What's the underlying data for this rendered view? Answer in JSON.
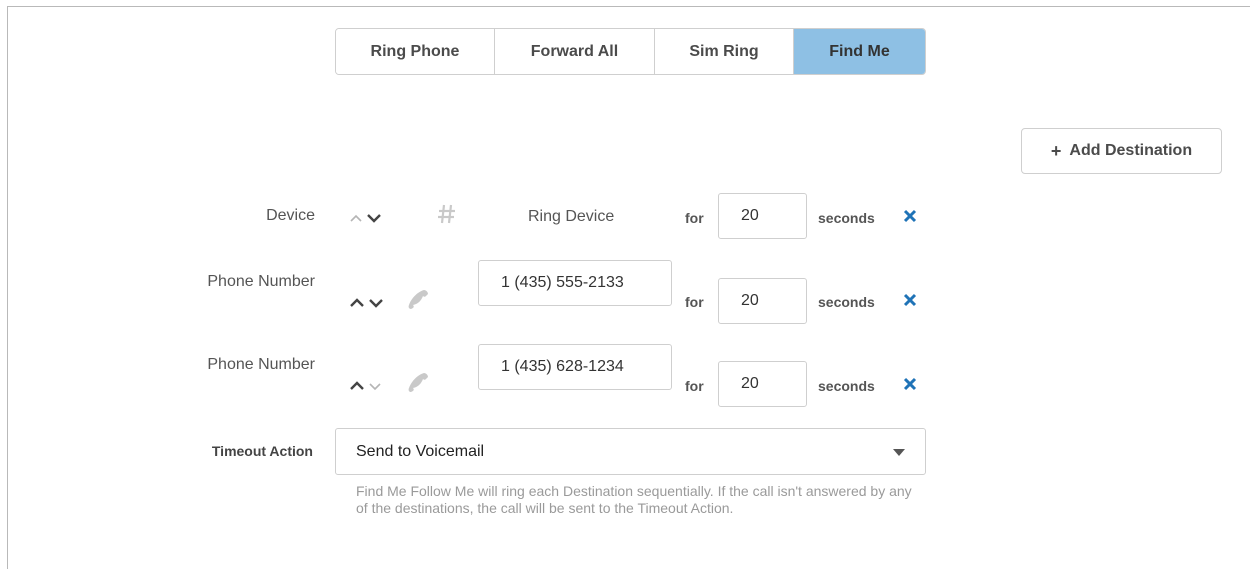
{
  "modes": {
    "tabs": [
      {
        "label": "Ring Phone",
        "active": false
      },
      {
        "label": "Forward All",
        "active": false
      },
      {
        "label": "Sim Ring",
        "active": false
      },
      {
        "label": "Find Me",
        "active": true
      }
    ]
  },
  "add_destination": {
    "label": "Add Destination",
    "icon": "plus-icon"
  },
  "destinations": [
    {
      "type_label": "Device",
      "icon": "hash-icon",
      "target_text": "Ring Device",
      "for_label": "for",
      "seconds": "20",
      "seconds_label": "seconds"
    },
    {
      "type_label": "Phone Number",
      "icon": "phone-icon",
      "number": "1 (435) 555-2133",
      "for_label": "for",
      "seconds": "20",
      "seconds_label": "seconds"
    },
    {
      "type_label": "Phone Number",
      "icon": "phone-icon",
      "number": "1 (435) 628-1234",
      "for_label": "for",
      "seconds": "20",
      "seconds_label": "seconds"
    }
  ],
  "timeout": {
    "label": "Timeout Action",
    "selected": "Send to Voicemail",
    "help": "Find Me Follow Me will ring each Destination sequentially. If the call isn't answered by any of the destinations, the call will be sent to the Timeout Action."
  },
  "colors": {
    "active_tab": "#8ec0e4",
    "delete_icon": "#1f73b7",
    "icon_gray": "#c9c9c9"
  }
}
